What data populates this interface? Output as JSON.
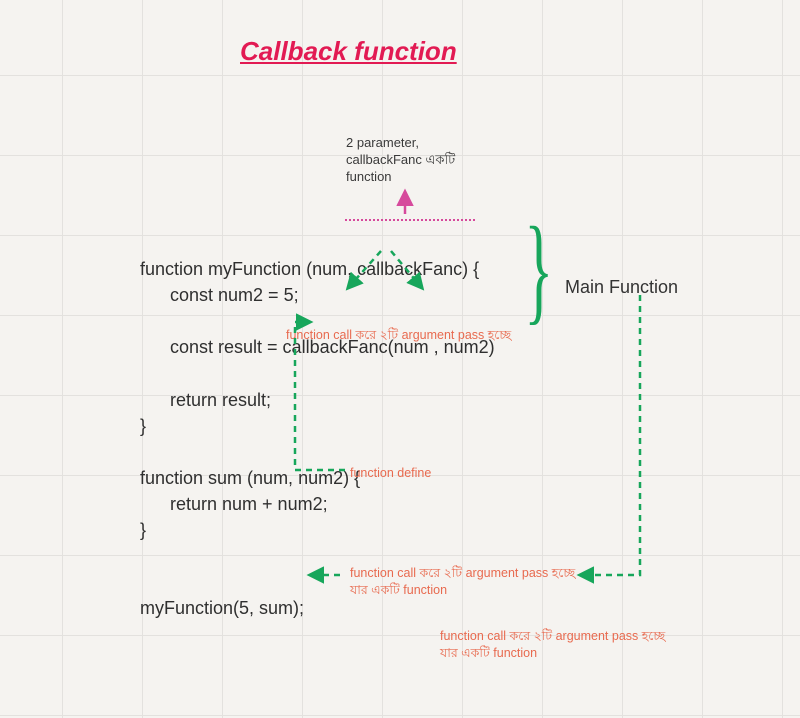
{
  "title": "Callback function",
  "parameter_note": {
    "line1": "2 parameter,",
    "line2": "callbackFanc একটি",
    "line3": "function"
  },
  "code": {
    "line1": "function myFunction (num, callbackFanc) {",
    "line2": "      const num2 = 5;",
    "line3": "",
    "line4": "      const result = callbackFanc(num , num2)",
    "line5": "",
    "line6": "      return result;",
    "line7": "}",
    "line8": "",
    "line9": "function sum (num, num2) {",
    "line10": "      return num + num2;",
    "line11": "}",
    "line12": "",
    "line13": "",
    "line14": "myFunction(5, sum);"
  },
  "main_function_label": "Main Function",
  "annotations": {
    "callback_call": "function call করে ২টি argument pass হচ্ছে",
    "function_define": "function define",
    "myfunction_call": "function call করে ২টি argument pass হচ্ছে\nযার একটি function",
    "myfunction_call_2": "function call করে ২টি argument pass হচ্ছে\nযার একটি function"
  },
  "colors": {
    "title": "#e21a53",
    "arrow_pink": "#d64a9c",
    "arrow_green": "#17a65b",
    "annotation": "#e86a4f"
  }
}
